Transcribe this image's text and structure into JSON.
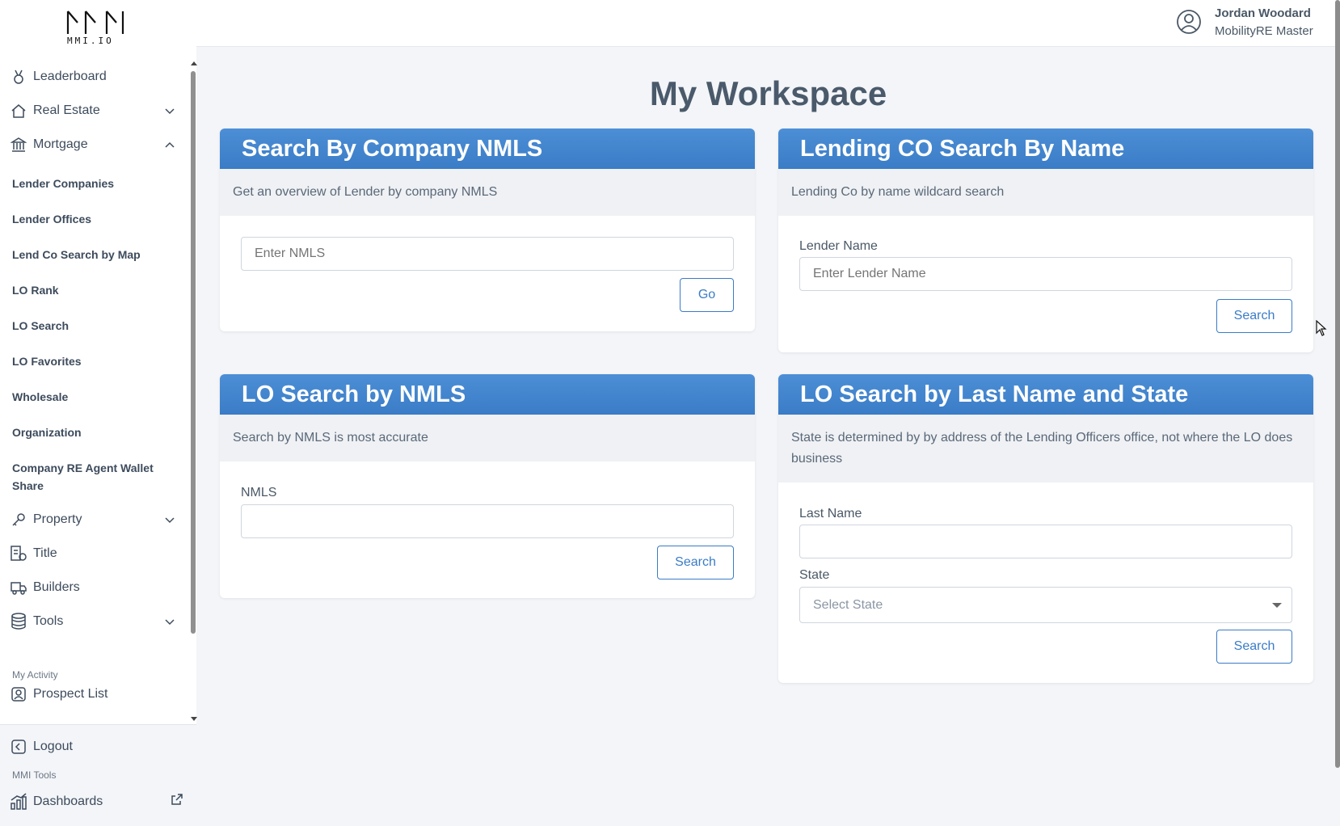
{
  "brand": {
    "logo_text": "MMI.IO"
  },
  "user": {
    "name": "Jordan Woodard",
    "role": "MobilityRE Master"
  },
  "sidebar": {
    "nav": [
      {
        "label": "Leaderboard",
        "icon": "medal-icon"
      },
      {
        "label": "Real Estate",
        "icon": "home-icon",
        "expand": "chevron-down-icon"
      },
      {
        "label": "Mortgage",
        "icon": "bank-icon",
        "expand": "chevron-up-icon"
      }
    ],
    "mortgage_items": [
      "Lender Companies",
      "Lender Offices",
      "Lend Co Search by Map",
      "LO Rank",
      "LO Search",
      "LO Favorites",
      "Wholesale",
      "Organization",
      "Company RE Agent Wallet Share"
    ],
    "nav2": [
      {
        "label": "Property",
        "icon": "key-icon",
        "expand": "chevron-down-icon"
      },
      {
        "label": "Title",
        "icon": "title-doc-icon"
      },
      {
        "label": "Builders",
        "icon": "truck-icon"
      },
      {
        "label": "Tools",
        "icon": "database-icon",
        "expand": "chevron-down-icon"
      }
    ],
    "my_activity_label": "My Activity",
    "prospect_list": "Prospect List",
    "logout": "Logout",
    "mmi_tools_label": "MMI Tools",
    "dashboards": "Dashboards"
  },
  "page": {
    "title": "My Workspace"
  },
  "cards": {
    "company_nmls": {
      "title": "Search By Company NMLS",
      "description": "Get an overview of Lender by company NMLS",
      "input_placeholder": "Enter NMLS",
      "button": "Go"
    },
    "lending_co_name": {
      "title": "Lending CO Search By Name",
      "description": "Lending Co by name wildcard search",
      "field_label": "Lender Name",
      "input_placeholder": "Enter Lender Name",
      "button": "Search"
    },
    "lo_nmls": {
      "title": "LO Search by NMLS",
      "description": "Search by NMLS is most accurate",
      "field_label": "NMLS",
      "input_value": "",
      "button": "Search"
    },
    "lo_last_name_state": {
      "title": "LO Search by Last Name and State",
      "description": "State is determined by by address of the Lending Officers office, not where the LO does business",
      "last_name_label": "Last Name",
      "last_name_value": "",
      "state_label": "State",
      "state_selected": "Select State",
      "button": "Search"
    }
  },
  "colors": {
    "accent": "#3a7cc6",
    "header_gradient_top": "#4d8fd6"
  }
}
